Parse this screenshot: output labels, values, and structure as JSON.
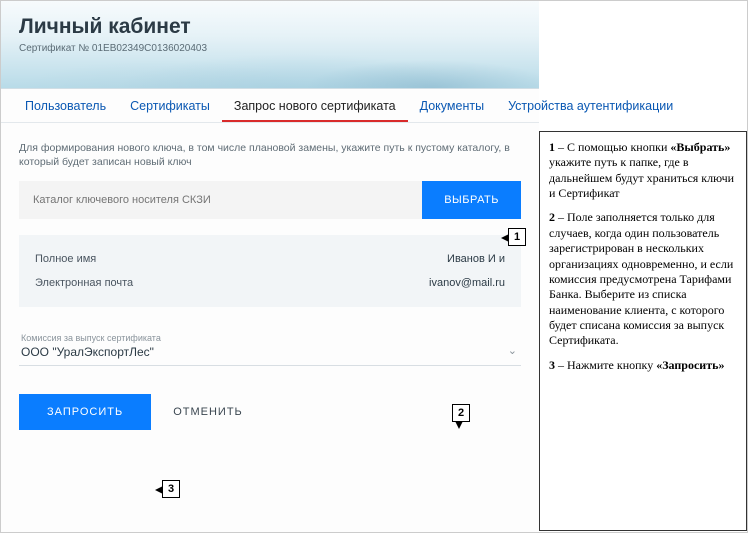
{
  "header": {
    "title": "Личный кабинет",
    "certificate_line": "Сертификат № 01EB02349C0136020403"
  },
  "tabs": [
    {
      "label": "Пользователь",
      "active": false
    },
    {
      "label": "Сертификаты",
      "active": false
    },
    {
      "label": "Запрос нового сертификата",
      "active": true
    },
    {
      "label": "Документы",
      "active": false
    },
    {
      "label": "Устройства аутентификации",
      "active": false
    }
  ],
  "form": {
    "hint": "Для формирования нового ключа, в том числе плановой замены, укажите путь к пустому каталогу, в который будет записан новый ключ",
    "catalog_placeholder": "Каталог ключевого носителя СКЗИ",
    "select_button": "ВЫБРАТЬ",
    "full_name_label": "Полное имя",
    "full_name_value": "Иванов И и",
    "email_label": "Электронная почта",
    "email_value": "ivanov@mail.ru",
    "commission_label": "Комиссия за выпуск сертификата",
    "commission_value": "ООО \"УралЭкспортЛес\"",
    "request_button": "ЗАПРОСИТЬ",
    "cancel_button": "ОТМЕНИТЬ"
  },
  "callouts": {
    "c1": "1",
    "c2": "2",
    "c3": "3"
  },
  "sidebar": {
    "p1_lead": "1",
    "p1_pre": " – С помощью кнопки ",
    "p1_bold": "«Выбрать»",
    "p1_post": " укажите путь к папке, где в дальнейшем будут храниться ключи и Сертификат",
    "p2_lead": "2",
    "p2_body": " – Поле заполняется только для случаев, когда один пользователь зарегистрирован в нескольких организациях одновременно, и если комиссия предусмотрена Тарифами Банка. Выберите из списка наименование клиента, с которого будет списана комиссия за выпуск Сертификата.",
    "p3_lead": "3",
    "p3_pre": " – Нажмите кнопку ",
    "p3_bold": "«Запросить»"
  }
}
